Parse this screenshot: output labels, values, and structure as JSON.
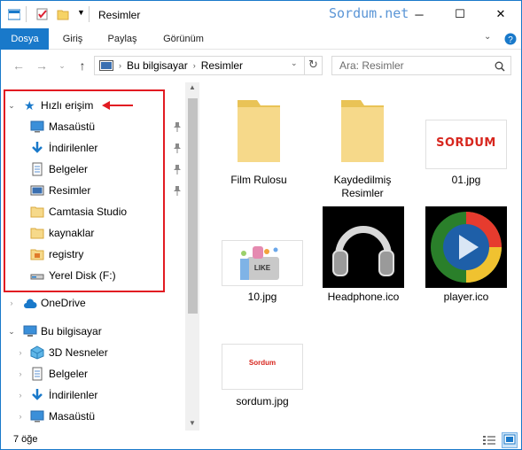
{
  "window": {
    "title": "Resimler",
    "watermark": "Sordum.net"
  },
  "ribbon": {
    "tabs": [
      "Dosya",
      "Giriş",
      "Paylaş",
      "Görünüm"
    ]
  },
  "address": {
    "segments": [
      "Bu bilgisayar",
      "Resimler"
    ],
    "search_placeholder": "Ara: Resimler"
  },
  "nav_pane": {
    "quick_access": "Hızlı erişim",
    "quick_items": [
      {
        "label": "Masaüstü",
        "icon": "desktop-icon",
        "pinned": true
      },
      {
        "label": "İndirilenler",
        "icon": "download-icon",
        "pinned": true
      },
      {
        "label": "Belgeler",
        "icon": "documents-icon",
        "pinned": true
      },
      {
        "label": "Resimler",
        "icon": "pictures-icon",
        "pinned": true
      },
      {
        "label": "Camtasia Studio",
        "icon": "folder-icon",
        "pinned": false
      },
      {
        "label": "kaynaklar",
        "icon": "folder-icon",
        "pinned": false
      },
      {
        "label": "registry",
        "icon": "registry-folder-icon",
        "pinned": false
      },
      {
        "label": "Yerel Disk (F:)",
        "icon": "drive-icon",
        "pinned": false
      }
    ],
    "onedrive": "OneDrive",
    "this_pc": "Bu bilgisayar",
    "pc_items": [
      {
        "label": "3D Nesneler",
        "icon": "3d-objects-icon"
      },
      {
        "label": "Belgeler",
        "icon": "documents-icon"
      },
      {
        "label": "İndirilenler",
        "icon": "download-icon"
      },
      {
        "label": "Masaüstü",
        "icon": "desktop-icon"
      }
    ]
  },
  "files": [
    {
      "name": "Film Rulosu",
      "kind": "folder"
    },
    {
      "name": "Kaydedilmiş Resimler",
      "kind": "folder"
    },
    {
      "name": "01.jpg",
      "kind": "image",
      "thumb_text": "SORDUM"
    },
    {
      "name": "10.jpg",
      "kind": "image",
      "thumb_text": "LIKE"
    },
    {
      "name": "Headphone.ico",
      "kind": "icon"
    },
    {
      "name": "player.ico",
      "kind": "icon"
    },
    {
      "name": "sordum.jpg",
      "kind": "image",
      "thumb_text": "Sordum"
    }
  ],
  "status": {
    "count": "7 öğe"
  },
  "colors": {
    "accent": "#1979ca",
    "highlight_box": "#e21b22",
    "folder": "#f6d365"
  }
}
